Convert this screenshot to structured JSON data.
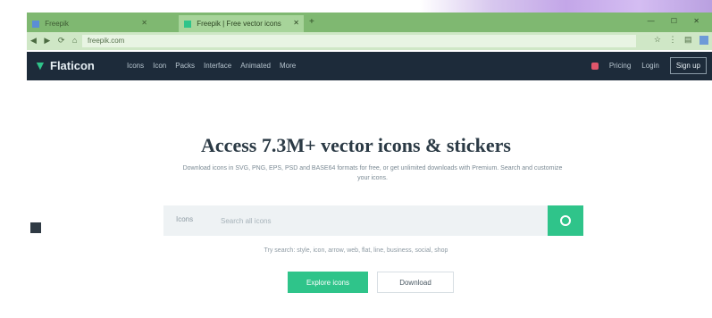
{
  "browser": {
    "tabs": [
      {
        "label": "Freepik",
        "active": false
      },
      {
        "label": "Freepik | Free vector icons",
        "active": true
      }
    ],
    "new_tab_symbol": "+",
    "window_controls": "— ☐ ✕",
    "url": "freepik.com"
  },
  "navbar": {
    "logo": "Flaticon",
    "links": [
      "Icons",
      "Icon",
      "Packs",
      "Interface",
      "Animated",
      "More"
    ],
    "right": {
      "pricing": "Pricing",
      "login": "Login",
      "signup": "Sign up"
    }
  },
  "hero": {
    "title": "Access 7.3M+ vector icons & stickers",
    "subtitle": "Download icons in SVG, PNG, EPS, PSD and BASE64 formats for free, or get unlimited downloads with Premium. Search and customize your icons."
  },
  "search": {
    "filter_label": "Icons",
    "placeholder": "Search all icons"
  },
  "hint": "Try search: style, icon, arrow, web, flat, line, business, social, shop",
  "cta": {
    "primary": "Explore icons",
    "secondary": "Download"
  },
  "colors": {
    "accent": "#2fc48a",
    "navbar_bg": "#1d2b3a",
    "tabbar_bg": "#7fb871"
  }
}
